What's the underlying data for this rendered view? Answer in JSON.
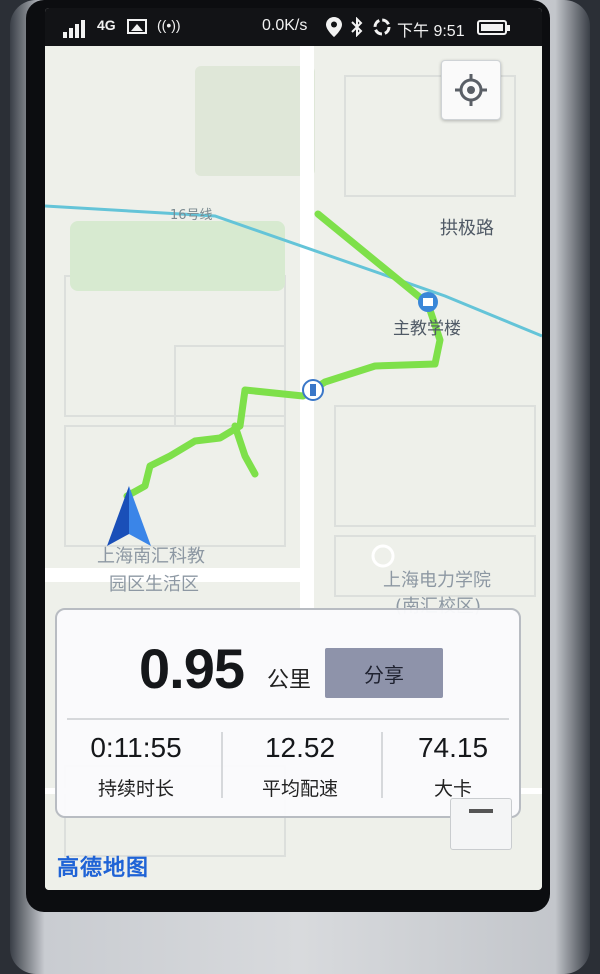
{
  "status_bar": {
    "network": "4G",
    "speed": "0.0K/s",
    "time": "下午 9:51"
  },
  "map": {
    "labels": {
      "road_gongji": "拱极路",
      "metro_line": "16号线",
      "main_building": "主教学楼",
      "campus_a_line1": "上海南汇科教",
      "campus_a_line2": "园区生活区",
      "campus_b_line1": "上海电力学院",
      "campus_b_line2": "(南汇校区)"
    },
    "route_color": "#7ee04a",
    "logo": "高德地图"
  },
  "stats": {
    "distance": "0.95",
    "distance_unit": "公里",
    "share_label": "分享",
    "duration_value": "0:11:55",
    "duration_label": "持续时长",
    "pace_value": "12.52",
    "pace_label": "平均配速",
    "calories_value": "74.15",
    "calories_label": "大卡"
  },
  "icons": [
    "signal-icon",
    "image-icon",
    "radio-icon",
    "location-icon",
    "bluetooth-icon",
    "sync-icon",
    "battery-icon",
    "locate-icon",
    "navigation-arrow-icon",
    "metro-station-icon",
    "building-icon"
  ]
}
